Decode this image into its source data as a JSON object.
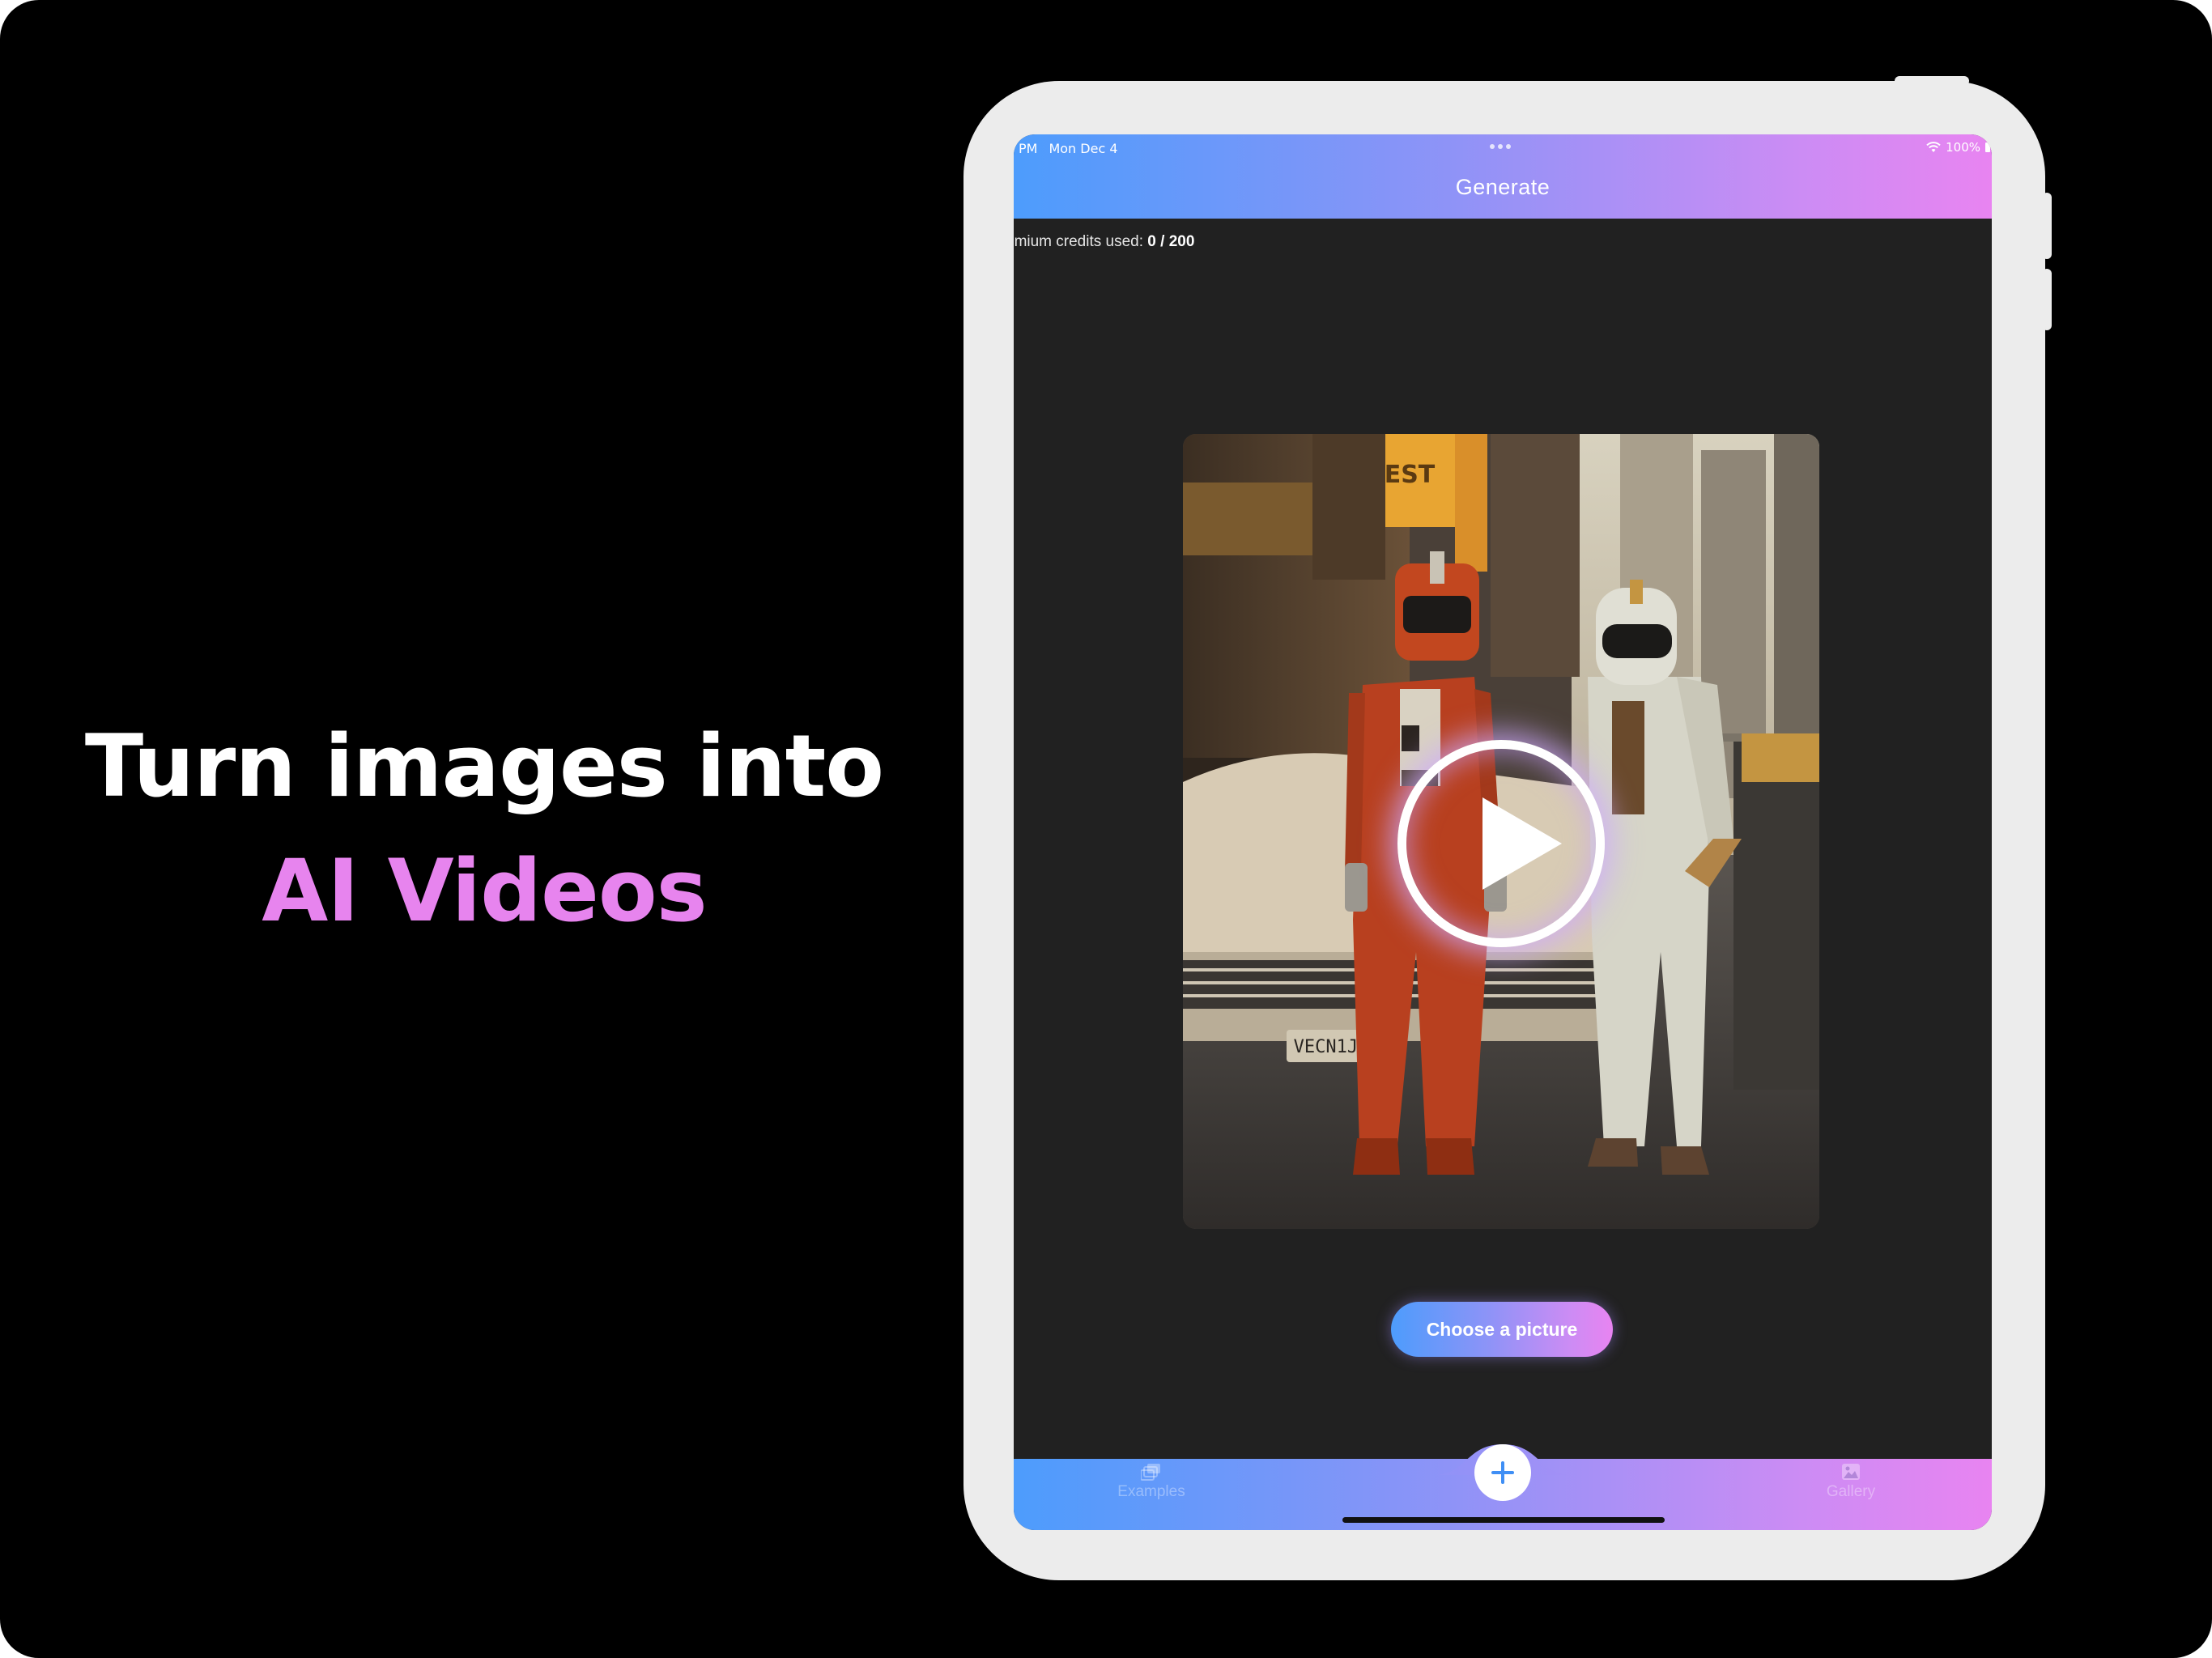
{
  "headline": {
    "line1": "Turn images into",
    "line2": "AI Videos"
  },
  "status_bar": {
    "time": "PM",
    "date": "Mon Dec 4",
    "battery": "100%"
  },
  "nav": {
    "title": "Generate"
  },
  "credits": {
    "label": "emium credits used:",
    "value": "0 / 200"
  },
  "preview": {
    "license_plate": "VECN1JB",
    "sign_text": "EST"
  },
  "choose_button": {
    "label": "Choose a picture"
  },
  "tabbar": {
    "examples_label": "Examples",
    "gallery_label": "Gallery"
  },
  "colors": {
    "gradient_start": "#4d9cfc",
    "gradient_end": "#e884f1",
    "headline_accent": "#e784ee",
    "screen_background": "#212121"
  },
  "icons": [
    "play-icon",
    "plus-icon",
    "examples-icon",
    "gallery-icon",
    "wifi-icon",
    "battery-icon"
  ]
}
